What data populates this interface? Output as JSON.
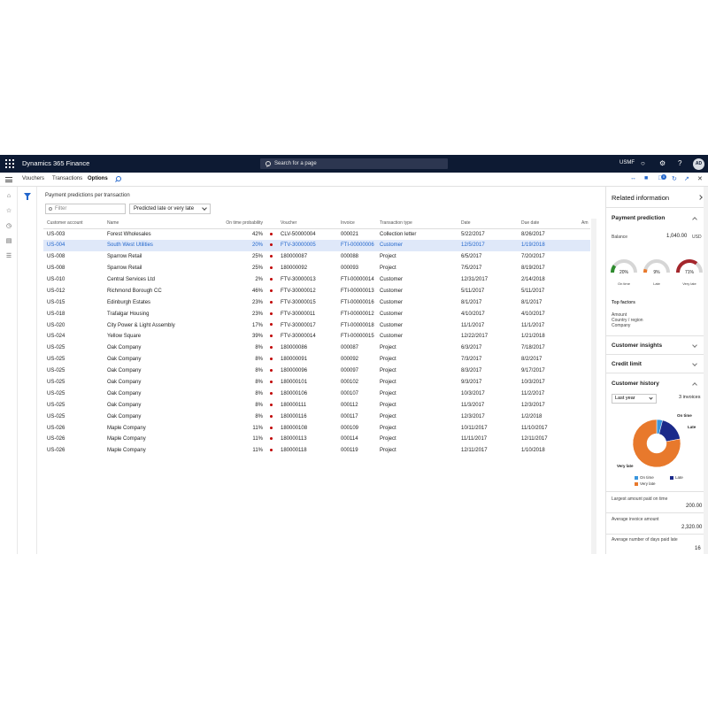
{
  "app": {
    "title": "Dynamics 365 Finance",
    "search_placeholder": "Search for a page",
    "company": "USMF",
    "user_initials": "AD"
  },
  "actionbar": {
    "tabs": [
      {
        "label": "Vouchers",
        "active": false
      },
      {
        "label": "Transactions",
        "active": false
      },
      {
        "label": "Options",
        "active": true
      }
    ],
    "badge_count": "0"
  },
  "main": {
    "section_title": "Payment predictions per transaction",
    "filter_placeholder": "Filter",
    "filter_select": "Predicted late or very late",
    "columns": [
      "Customer account",
      "Name",
      "On time probability",
      "",
      "Voucher",
      "Invoice",
      "Transaction type",
      "Date",
      "Due date",
      "Am"
    ],
    "rows": [
      {
        "account": "US-003",
        "name": "Forest Wholesales",
        "prob": "42%",
        "voucher": "CLV-50000004",
        "invoice": "000021",
        "type": "Collection letter",
        "date": "5/22/2017",
        "due": "8/26/2017",
        "selected": false
      },
      {
        "account": "US-004",
        "name": "South West Utilities",
        "prob": "20%",
        "voucher": "FTV-30000005",
        "invoice": "FTI-00000006",
        "type": "Customer",
        "date": "12/5/2017",
        "due": "1/19/2018",
        "selected": true
      },
      {
        "account": "US-008",
        "name": "Sparrow Retail",
        "prob": "25%",
        "voucher": "180000087",
        "invoice": "000088",
        "type": "Project",
        "date": "6/5/2017",
        "due": "7/20/2017",
        "selected": false
      },
      {
        "account": "US-008",
        "name": "Sparrow Retail",
        "prob": "25%",
        "voucher": "180000092",
        "invoice": "000093",
        "type": "Project",
        "date": "7/5/2017",
        "due": "8/19/2017",
        "selected": false
      },
      {
        "account": "US-010",
        "name": "Central Services Ltd",
        "prob": "2%",
        "voucher": "FTV-30000013",
        "invoice": "FTI-00000014",
        "type": "Customer",
        "date": "12/31/2017",
        "due": "2/14/2018",
        "selected": false
      },
      {
        "account": "US-012",
        "name": "Richmond Borough CC",
        "prob": "46%",
        "voucher": "FTV-30000012",
        "invoice": "FTI-00000013",
        "type": "Customer",
        "date": "5/11/2017",
        "due": "5/11/2017",
        "selected": false
      },
      {
        "account": "US-015",
        "name": "Edinburgh Estates",
        "prob": "23%",
        "voucher": "FTV-30000015",
        "invoice": "FTI-00000016",
        "type": "Customer",
        "date": "8/1/2017",
        "due": "8/1/2017",
        "selected": false
      },
      {
        "account": "US-018",
        "name": "Trafalgar Housing",
        "prob": "23%",
        "voucher": "FTV-30000011",
        "invoice": "FTI-00000012",
        "type": "Customer",
        "date": "4/10/2017",
        "due": "4/10/2017",
        "selected": false
      },
      {
        "account": "US-020",
        "name": "City Power & Light Assembly",
        "prob": "17%",
        "voucher": "FTV-30000017",
        "invoice": "FTI-00000018",
        "type": "Customer",
        "date": "11/1/2017",
        "due": "11/1/2017",
        "selected": false
      },
      {
        "account": "US-024",
        "name": "Yellow Square",
        "prob": "39%",
        "voucher": "FTV-30000014",
        "invoice": "FTI-00000015",
        "type": "Customer",
        "date": "12/22/2017",
        "due": "1/21/2018",
        "selected": false
      },
      {
        "account": "US-025",
        "name": "Oak Company",
        "prob": "8%",
        "voucher": "180000086",
        "invoice": "000087",
        "type": "Project",
        "date": "6/3/2017",
        "due": "7/18/2017",
        "selected": false
      },
      {
        "account": "US-025",
        "name": "Oak Company",
        "prob": "8%",
        "voucher": "180000091",
        "invoice": "000092",
        "type": "Project",
        "date": "7/3/2017",
        "due": "8/2/2017",
        "selected": false
      },
      {
        "account": "US-025",
        "name": "Oak Company",
        "prob": "8%",
        "voucher": "180000096",
        "invoice": "000097",
        "type": "Project",
        "date": "8/3/2017",
        "due": "9/17/2017",
        "selected": false
      },
      {
        "account": "US-025",
        "name": "Oak Company",
        "prob": "8%",
        "voucher": "180000101",
        "invoice": "000102",
        "type": "Project",
        "date": "9/3/2017",
        "due": "10/3/2017",
        "selected": false
      },
      {
        "account": "US-025",
        "name": "Oak Company",
        "prob": "8%",
        "voucher": "180000106",
        "invoice": "000107",
        "type": "Project",
        "date": "10/3/2017",
        "due": "11/2/2017",
        "selected": false
      },
      {
        "account": "US-025",
        "name": "Oak Company",
        "prob": "8%",
        "voucher": "180000111",
        "invoice": "000112",
        "type": "Project",
        "date": "11/3/2017",
        "due": "12/3/2017",
        "selected": false
      },
      {
        "account": "US-025",
        "name": "Oak Company",
        "prob": "8%",
        "voucher": "180000116",
        "invoice": "000117",
        "type": "Project",
        "date": "12/3/2017",
        "due": "1/2/2018",
        "selected": false
      },
      {
        "account": "US-026",
        "name": "Maple Company",
        "prob": "11%",
        "voucher": "180000108",
        "invoice": "000109",
        "type": "Project",
        "date": "10/11/2017",
        "due": "11/10/2017",
        "selected": false
      },
      {
        "account": "US-026",
        "name": "Maple Company",
        "prob": "11%",
        "voucher": "180000113",
        "invoice": "000114",
        "type": "Project",
        "date": "11/11/2017",
        "due": "12/11/2017",
        "selected": false
      },
      {
        "account": "US-026",
        "name": "Maple Company",
        "prob": "11%",
        "voucher": "180000118",
        "invoice": "000119",
        "type": "Project",
        "date": "12/11/2017",
        "due": "1/10/2018",
        "selected": false
      }
    ]
  },
  "rpanel": {
    "title": "Related information",
    "payment_prediction": {
      "title": "Payment prediction",
      "balance_label": "Balance",
      "balance_value": "1,040.00",
      "currency": "USD",
      "gauges": [
        {
          "label": "On time",
          "value_text": "20%",
          "value": 0.2,
          "color": "#2e8b2e"
        },
        {
          "label": "Late",
          "value_text": "9%",
          "value": 0.09,
          "color": "#e8792c"
        },
        {
          "label": "Very late",
          "value_text": "71%",
          "value": 0.71,
          "color": "#a4262c"
        }
      ],
      "top_factors_label": "Top factors",
      "factors": [
        "Amount",
        "Country / region",
        "Company"
      ]
    },
    "customer_insights": "Customer insights",
    "credit_limit": "Credit limit",
    "customer_history": {
      "title": "Customer history",
      "period": "Last year",
      "invoices": "3 invoices",
      "chart_labels": [
        "On time",
        "Late",
        "Very late"
      ],
      "legend": [
        {
          "label": "On time",
          "color": "#3a96dd"
        },
        {
          "label": "Late",
          "color": "#1b2a8a"
        },
        {
          "label": "Very late",
          "color": "#e8792c"
        }
      ],
      "largest_label": "Largest amount paid on time",
      "largest_value": "200.00",
      "average_label": "Average invoice amount",
      "average_value": "2,320.00",
      "days_label": "Average number of days paid late",
      "days_value": "16"
    }
  },
  "chart_data": {
    "type": "pie",
    "categories": [
      "On time",
      "Late",
      "Very late"
    ],
    "values": [
      4,
      18,
      78
    ],
    "colors": [
      "#3a96dd",
      "#1b2a8a",
      "#e8792c"
    ],
    "title": ""
  }
}
